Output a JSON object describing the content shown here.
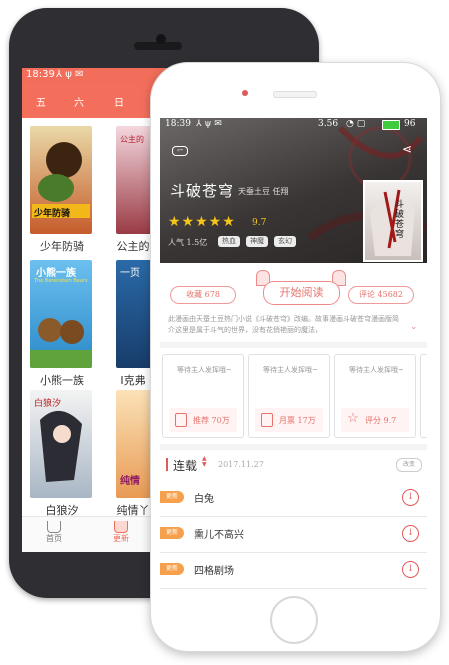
{
  "back_phone": {
    "status_time": "18:39",
    "tabs": [
      "五",
      "六",
      "日"
    ],
    "comics": [
      {
        "title": "少年防骑",
        "cover_text": "少年防骑"
      },
      {
        "title": "公主的",
        "cover_text": "公主的"
      },
      {
        "title": "小熊一族",
        "cover_text": "小熊一族",
        "cover_subtext": "The Berenstain Bears"
      },
      {
        "title": "I克弗",
        "cover_text": "一页"
      },
      {
        "title": "白狼汐",
        "cover_text": "白狼汐"
      },
      {
        "title": "纯情丫",
        "cover_text": "纯情"
      }
    ],
    "nav": [
      {
        "label": "首页",
        "icon": "cup-icon"
      },
      {
        "label": "更新",
        "icon": "cup-icon"
      }
    ]
  },
  "front_phone": {
    "status_time": "18:39",
    "network_speed": "3.56",
    "battery": "96",
    "comic_title": "斗破苍穹",
    "authors": "天蚕土豆 任翔",
    "rating": "9.7",
    "stars": 5,
    "popularity": "人气 1.5亿",
    "tags": [
      "热血",
      "神魔",
      "玄幻"
    ],
    "cover_text": "斗破苍穹",
    "favorites": "收藏 678",
    "start_reading": "开始阅读",
    "comments": "评论 45682",
    "description": "此漫画由天蚕土豆热门小说《斗破苍穹》改编。故事漫画斗破苍穹漫画版简介这里是属于斗气的世界，没有花俏艳丽的魔法，",
    "cards": [
      {
        "placeholder": "等待主人发挥哦~",
        "stat": "推荐 70万",
        "icon": "calendar-icon"
      },
      {
        "placeholder": "等待主人发挥哦~",
        "stat": "月票 17万",
        "icon": "ticket-icon"
      },
      {
        "placeholder": "等待主人发挥哦~",
        "stat": "评分 9.7",
        "icon": "star-icon"
      }
    ],
    "section_title": "连载",
    "section_date": "2017.11.27",
    "sort_label": "改变",
    "chapters": [
      {
        "badge": "更新",
        "name": "白兔"
      },
      {
        "badge": "更新",
        "name": "熏儿不高兴"
      },
      {
        "badge": "更新",
        "name": "四格剧场"
      }
    ],
    "colors": {
      "accent": "#f26d5a",
      "badge": "#f5a04c",
      "star": "#f5c518"
    }
  }
}
